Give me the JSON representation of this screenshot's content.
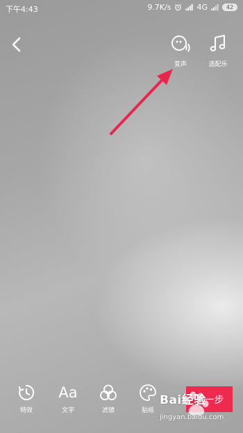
{
  "status_bar": {
    "time": "下午4:43",
    "speed": "9.7K/s",
    "network": "4G",
    "battery": "42"
  },
  "top_tools": [
    {
      "label": "变声",
      "icon": "voice-change-icon"
    },
    {
      "label": "选配乐",
      "icon": "music-note-icon"
    }
  ],
  "bottom_tools": [
    {
      "label": "特效",
      "icon": "effects-timer-icon"
    },
    {
      "label": "文字",
      "icon": "text-aa-icon",
      "glyph": "Aa"
    },
    {
      "label": "滤镜",
      "icon": "filter-circles-icon"
    },
    {
      "label": "贴纸",
      "icon": "sticker-palette-icon"
    }
  ],
  "next_button": {
    "label": "下一步"
  },
  "watermark": {
    "logo": "Bai经验",
    "url": "jingyan.baidu.com"
  },
  "colors": {
    "accent": "#f0294f",
    "annotation_arrow": "#e8264e"
  }
}
